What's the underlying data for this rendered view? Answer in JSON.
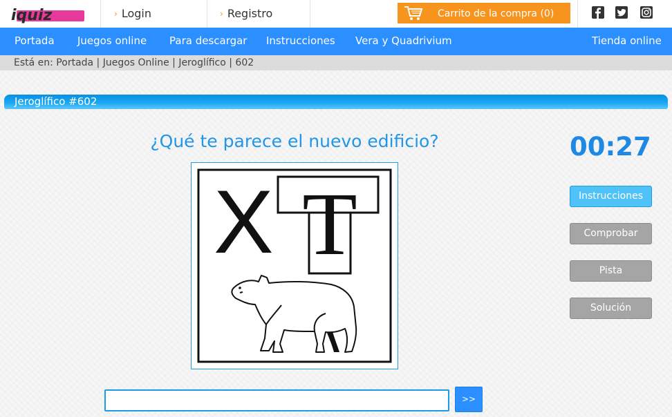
{
  "brand": {
    "logo_text": "iquiz"
  },
  "topbar": {
    "login_label": "Login",
    "register_label": "Registro",
    "cart_label": "Carrito de la compra (0)"
  },
  "social": {
    "icons": [
      "facebook-icon",
      "twitter-icon",
      "instagram-icon"
    ]
  },
  "nav": {
    "items": [
      {
        "label": "Portada"
      },
      {
        "label": "Juegos online"
      },
      {
        "label": "Para descargar"
      },
      {
        "label": "Instrucciones"
      },
      {
        "label": "Vera y Quadrivium"
      }
    ],
    "shop_label": "Tienda online"
  },
  "breadcrumb": {
    "text": "Está en: Portada | Juegos Online | Jeroglífico | 602"
  },
  "section": {
    "title": "Jeroglífico #602"
  },
  "puzzle": {
    "question": "¿Qué te parece el nuevo edificio?",
    "image_letters": {
      "left": "X",
      "boxed": "T"
    }
  },
  "timer": {
    "value": "00:27"
  },
  "actions": {
    "instructions_label": "Instrucciones",
    "check_label": "Comprobar",
    "hint_label": "Pista",
    "solution_label": "Solución"
  },
  "answer": {
    "value": "",
    "placeholder": "",
    "submit_label": ">>"
  },
  "colors": {
    "nav_blue": "#2b8fff",
    "accent_orange": "#f7941d",
    "title_blue": "#2196e8",
    "timer_blue": "#1e88e5",
    "logo_pink": "#e6399b"
  }
}
